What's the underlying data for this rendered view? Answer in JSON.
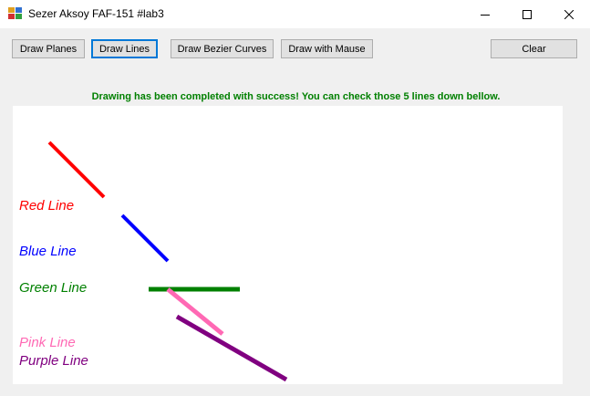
{
  "window": {
    "title": "Sezer Aksoy FAF-151 #lab3"
  },
  "toolbar": {
    "draw_planes_label": "Draw Planes",
    "draw_lines_label": "Draw Lines",
    "draw_bezier_label": "Draw Bezier Curves",
    "draw_mouse_label": "Draw with Mause",
    "clear_label": "Clear"
  },
  "status": {
    "message": "Drawing has been completed with success! You can check those 5 lines down bellow."
  },
  "canvas": {
    "labels": {
      "red": "Red Line",
      "blue": "Blue Line",
      "green": "Green Line",
      "pink": "Pink Line",
      "purple": "Purple Line"
    },
    "colors": {
      "red": "#ff0000",
      "blue": "#0000ff",
      "green": "#008000",
      "pink": "#ff69b4",
      "purple": "#800080"
    }
  }
}
